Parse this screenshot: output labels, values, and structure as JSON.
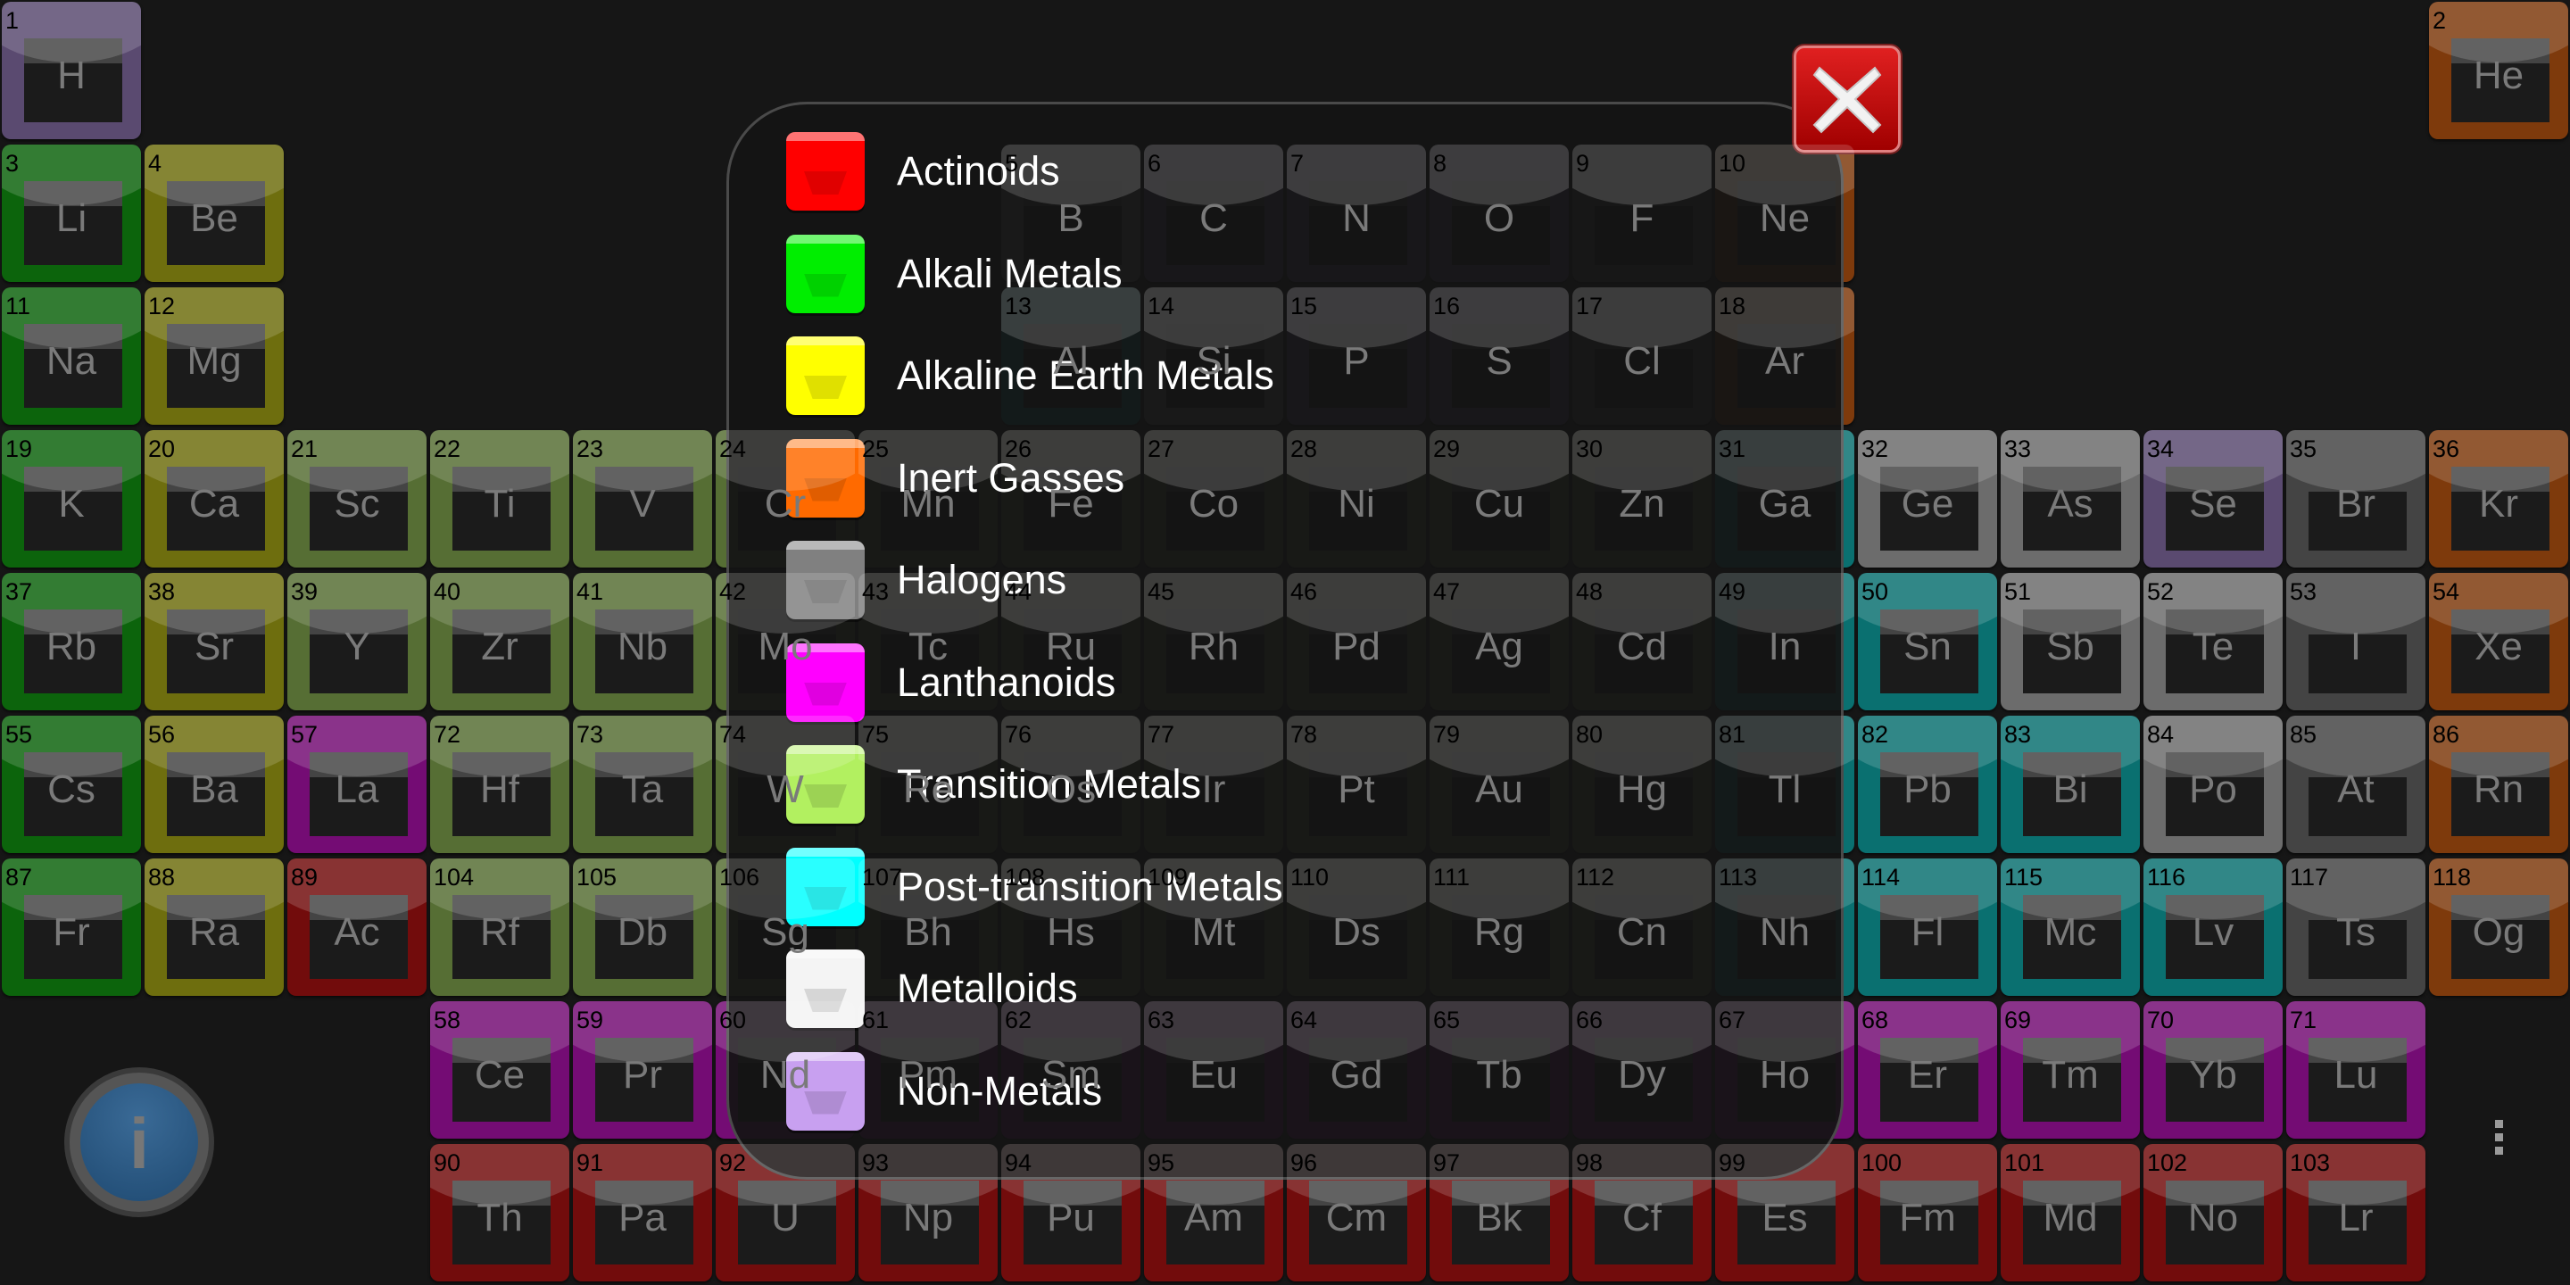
{
  "legend": {
    "items": [
      {
        "label": "Actinoids",
        "color": "#ff0000"
      },
      {
        "label": "Alkali Metals",
        "color": "#00ee00"
      },
      {
        "label": "Alkaline Earth Metals",
        "color": "#ffff00"
      },
      {
        "label": "Inert Gasses",
        "color": "#ff6a00"
      },
      {
        "label": "Halogens",
        "color": "#808080"
      },
      {
        "label": "Lanthanoids",
        "color": "#ff00ff"
      },
      {
        "label": "Transition Metals",
        "color": "#b2f060"
      },
      {
        "label": "Post-transition Metals",
        "color": "#00ffff"
      },
      {
        "label": "Metalloids",
        "color": "#f4f4f4"
      },
      {
        "label": "Non-Metals",
        "color": "#c8a0f0"
      }
    ]
  },
  "category_tile_colors": {
    "nonmetal": "#5a4a70",
    "alkali": "#0c640c",
    "alkaline": "#6e6e0e",
    "transition": "#566e34",
    "post": "#0a7070",
    "metalloid": "#6c6c6c",
    "halogen": "#444444",
    "noble": "#7e3a0c",
    "lanthanoid": "#740c74",
    "actinoid": "#720c0c"
  },
  "close_button": {
    "icon": "close-x-icon",
    "color": "#d01010"
  },
  "info_button": {
    "icon": "info-icon",
    "label": "i"
  },
  "menu": {
    "icon": "overflow-menu-icon"
  },
  "elements": [
    {
      "n": "1",
      "s": "H",
      "c": "nonmetal"
    },
    {
      "n": "2",
      "s": "He",
      "c": "noble"
    },
    {
      "n": "3",
      "s": "Li",
      "c": "alkali"
    },
    {
      "n": "4",
      "s": "Be",
      "c": "alkaline"
    },
    {
      "n": "5",
      "s": "B",
      "c": "metalloid"
    },
    {
      "n": "6",
      "s": "C",
      "c": "nonmetal"
    },
    {
      "n": "7",
      "s": "N",
      "c": "nonmetal"
    },
    {
      "n": "8",
      "s": "O",
      "c": "nonmetal"
    },
    {
      "n": "9",
      "s": "F",
      "c": "halogen"
    },
    {
      "n": "10",
      "s": "Ne",
      "c": "noble"
    },
    {
      "n": "11",
      "s": "Na",
      "c": "alkali"
    },
    {
      "n": "12",
      "s": "Mg",
      "c": "alkaline"
    },
    {
      "n": "13",
      "s": "Al",
      "c": "post"
    },
    {
      "n": "14",
      "s": "Si",
      "c": "metalloid"
    },
    {
      "n": "15",
      "s": "P",
      "c": "nonmetal"
    },
    {
      "n": "16",
      "s": "S",
      "c": "nonmetal"
    },
    {
      "n": "17",
      "s": "Cl",
      "c": "halogen"
    },
    {
      "n": "18",
      "s": "Ar",
      "c": "noble"
    },
    {
      "n": "19",
      "s": "K",
      "c": "alkali"
    },
    {
      "n": "20",
      "s": "Ca",
      "c": "alkaline"
    },
    {
      "n": "21",
      "s": "Sc",
      "c": "transition"
    },
    {
      "n": "22",
      "s": "Ti",
      "c": "transition"
    },
    {
      "n": "23",
      "s": "V",
      "c": "transition"
    },
    {
      "n": "24",
      "s": "Cr",
      "c": "transition"
    },
    {
      "n": "25",
      "s": "Mn",
      "c": "transition"
    },
    {
      "n": "26",
      "s": "Fe",
      "c": "transition"
    },
    {
      "n": "27",
      "s": "Co",
      "c": "transition"
    },
    {
      "n": "28",
      "s": "Ni",
      "c": "transition"
    },
    {
      "n": "29",
      "s": "Cu",
      "c": "transition"
    },
    {
      "n": "30",
      "s": "Zn",
      "c": "transition"
    },
    {
      "n": "31",
      "s": "Ga",
      "c": "post"
    },
    {
      "n": "32",
      "s": "Ge",
      "c": "metalloid"
    },
    {
      "n": "33",
      "s": "As",
      "c": "metalloid"
    },
    {
      "n": "34",
      "s": "Se",
      "c": "nonmetal"
    },
    {
      "n": "35",
      "s": "Br",
      "c": "halogen"
    },
    {
      "n": "36",
      "s": "Kr",
      "c": "noble"
    },
    {
      "n": "37",
      "s": "Rb",
      "c": "alkali"
    },
    {
      "n": "38",
      "s": "Sr",
      "c": "alkaline"
    },
    {
      "n": "39",
      "s": "Y",
      "c": "transition"
    },
    {
      "n": "40",
      "s": "Zr",
      "c": "transition"
    },
    {
      "n": "41",
      "s": "Nb",
      "c": "transition"
    },
    {
      "n": "42",
      "s": "Mo",
      "c": "transition"
    },
    {
      "n": "43",
      "s": "Tc",
      "c": "transition"
    },
    {
      "n": "44",
      "s": "Ru",
      "c": "transition"
    },
    {
      "n": "45",
      "s": "Rh",
      "c": "transition"
    },
    {
      "n": "46",
      "s": "Pd",
      "c": "transition"
    },
    {
      "n": "47",
      "s": "Ag",
      "c": "transition"
    },
    {
      "n": "48",
      "s": "Cd",
      "c": "transition"
    },
    {
      "n": "49",
      "s": "In",
      "c": "post"
    },
    {
      "n": "50",
      "s": "Sn",
      "c": "post"
    },
    {
      "n": "51",
      "s": "Sb",
      "c": "metalloid"
    },
    {
      "n": "52",
      "s": "Te",
      "c": "metalloid"
    },
    {
      "n": "53",
      "s": "I",
      "c": "halogen"
    },
    {
      "n": "54",
      "s": "Xe",
      "c": "noble"
    },
    {
      "n": "55",
      "s": "Cs",
      "c": "alkali"
    },
    {
      "n": "56",
      "s": "Ba",
      "c": "alkaline"
    },
    {
      "n": "57",
      "s": "La",
      "c": "lanthanoid"
    },
    {
      "n": "58",
      "s": "Ce",
      "c": "lanthanoid"
    },
    {
      "n": "59",
      "s": "Pr",
      "c": "lanthanoid"
    },
    {
      "n": "60",
      "s": "Nd",
      "c": "lanthanoid"
    },
    {
      "n": "61",
      "s": "Pm",
      "c": "lanthanoid"
    },
    {
      "n": "62",
      "s": "Sm",
      "c": "lanthanoid"
    },
    {
      "n": "63",
      "s": "Eu",
      "c": "lanthanoid"
    },
    {
      "n": "64",
      "s": "Gd",
      "c": "lanthanoid"
    },
    {
      "n": "65",
      "s": "Tb",
      "c": "lanthanoid"
    },
    {
      "n": "66",
      "s": "Dy",
      "c": "lanthanoid"
    },
    {
      "n": "67",
      "s": "Ho",
      "c": "lanthanoid"
    },
    {
      "n": "68",
      "s": "Er",
      "c": "lanthanoid"
    },
    {
      "n": "69",
      "s": "Tm",
      "c": "lanthanoid"
    },
    {
      "n": "70",
      "s": "Yb",
      "c": "lanthanoid"
    },
    {
      "n": "71",
      "s": "Lu",
      "c": "lanthanoid"
    },
    {
      "n": "72",
      "s": "Hf",
      "c": "transition"
    },
    {
      "n": "73",
      "s": "Ta",
      "c": "transition"
    },
    {
      "n": "74",
      "s": "W",
      "c": "transition"
    },
    {
      "n": "75",
      "s": "Re",
      "c": "transition"
    },
    {
      "n": "76",
      "s": "Os",
      "c": "transition"
    },
    {
      "n": "77",
      "s": "Ir",
      "c": "transition"
    },
    {
      "n": "78",
      "s": "Pt",
      "c": "transition"
    },
    {
      "n": "79",
      "s": "Au",
      "c": "transition"
    },
    {
      "n": "80",
      "s": "Hg",
      "c": "transition"
    },
    {
      "n": "81",
      "s": "Tl",
      "c": "post"
    },
    {
      "n": "82",
      "s": "Pb",
      "c": "post"
    },
    {
      "n": "83",
      "s": "Bi",
      "c": "post"
    },
    {
      "n": "84",
      "s": "Po",
      "c": "metalloid"
    },
    {
      "n": "85",
      "s": "At",
      "c": "halogen"
    },
    {
      "n": "86",
      "s": "Rn",
      "c": "noble"
    },
    {
      "n": "87",
      "s": "Fr",
      "c": "alkali"
    },
    {
      "n": "88",
      "s": "Ra",
      "c": "alkaline"
    },
    {
      "n": "89",
      "s": "Ac",
      "c": "actinoid"
    },
    {
      "n": "90",
      "s": "Th",
      "c": "actinoid"
    },
    {
      "n": "91",
      "s": "Pa",
      "c": "actinoid"
    },
    {
      "n": "92",
      "s": "U",
      "c": "actinoid"
    },
    {
      "n": "93",
      "s": "Np",
      "c": "actinoid"
    },
    {
      "n": "94",
      "s": "Pu",
      "c": "actinoid"
    },
    {
      "n": "95",
      "s": "Am",
      "c": "actinoid"
    },
    {
      "n": "96",
      "s": "Cm",
      "c": "actinoid"
    },
    {
      "n": "97",
      "s": "Bk",
      "c": "actinoid"
    },
    {
      "n": "98",
      "s": "Cf",
      "c": "actinoid"
    },
    {
      "n": "99",
      "s": "Es",
      "c": "actinoid"
    },
    {
      "n": "100",
      "s": "Fm",
      "c": "actinoid"
    },
    {
      "n": "101",
      "s": "Md",
      "c": "actinoid"
    },
    {
      "n": "102",
      "s": "No",
      "c": "actinoid"
    },
    {
      "n": "103",
      "s": "Lr",
      "c": "actinoid"
    },
    {
      "n": "104",
      "s": "Rf",
      "c": "transition"
    },
    {
      "n": "105",
      "s": "Db",
      "c": "transition"
    },
    {
      "n": "106",
      "s": "Sg",
      "c": "transition"
    },
    {
      "n": "107",
      "s": "Bh",
      "c": "transition"
    },
    {
      "n": "108",
      "s": "Hs",
      "c": "transition"
    },
    {
      "n": "109",
      "s": "Mt",
      "c": "transition"
    },
    {
      "n": "110",
      "s": "Ds",
      "c": "transition"
    },
    {
      "n": "111",
      "s": "Rg",
      "c": "transition"
    },
    {
      "n": "112",
      "s": "Cn",
      "c": "transition"
    },
    {
      "n": "113",
      "s": "Nh",
      "c": "post"
    },
    {
      "n": "114",
      "s": "Fl",
      "c": "post"
    },
    {
      "n": "115",
      "s": "Mc",
      "c": "post"
    },
    {
      "n": "116",
      "s": "Lv",
      "c": "post"
    },
    {
      "n": "117",
      "s": "Ts",
      "c": "halogen"
    },
    {
      "n": "118",
      "s": "Og",
      "c": "noble"
    }
  ]
}
